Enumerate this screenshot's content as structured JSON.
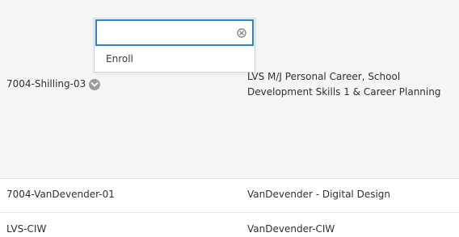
{
  "rows": [
    {
      "course_id": "7004-Shilling-03",
      "course_name": "LVS M/J Personal Career, School Development Skills 1 & Career Planning"
    },
    {
      "course_id": "7004-VanDevender-01",
      "course_name": "VanDevender - Digital Design"
    },
    {
      "course_id": "LVS-CIW",
      "course_name": "VanDevender-CIW"
    }
  ],
  "menu": {
    "search_value": "",
    "search_placeholder": "",
    "items": [
      {
        "label": "Enroll"
      }
    ]
  },
  "icons": {
    "options": "chevron-down-icon",
    "clear": "clear-icon"
  },
  "colors": {
    "focus_border": "#2f7fc1",
    "highlight_row": "#f5f5f5",
    "chevron_badge": "#9c9c9c"
  }
}
